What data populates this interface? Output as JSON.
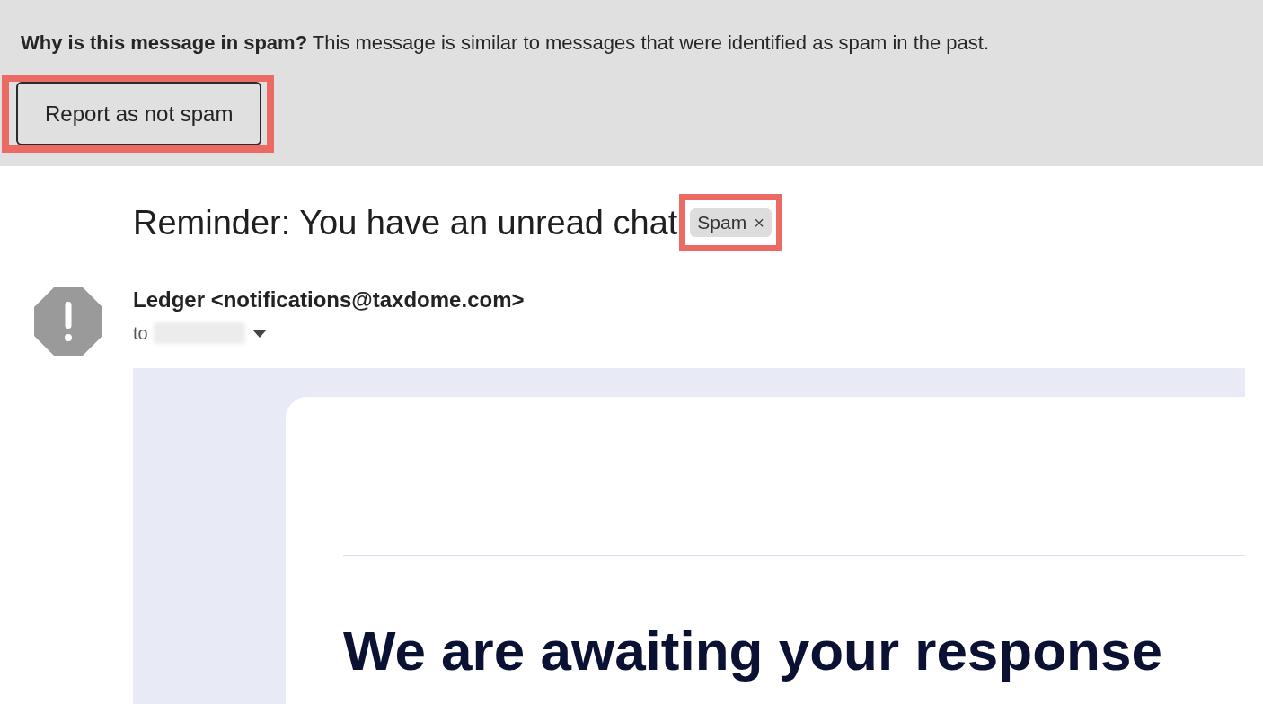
{
  "spam_banner": {
    "message": "**Why is this message in spam?** This message is similar to messages that were identified as spam in the past.",
    "button": {
      "label": "Report as not spam",
      "highlighted": true
    }
  },
  "subject": {
    "text": "Reminder: You have an unread chat",
    "label": {
      "text": "Spam",
      "remove": "×",
      "highlighted": true
    }
  },
  "sender": {
    "name": "Ledger <notifications@taxdome.com>",
    "to_label": "to"
  },
  "email_body": {
    "heading": "We are awaiting your response"
  }
}
